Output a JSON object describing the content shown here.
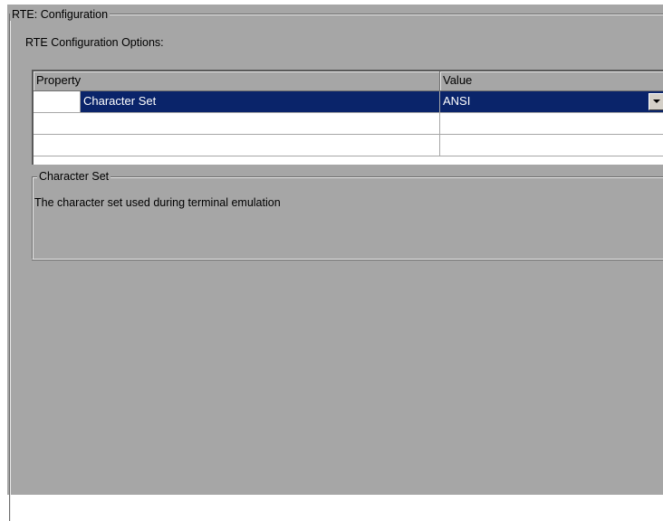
{
  "group": {
    "title": "RTE: Configuration",
    "options_label": "RTE Configuration Options:"
  },
  "grid": {
    "columns": [
      "Property",
      "Value"
    ],
    "rows": [
      {
        "property": "Character Set",
        "value": "ANSI",
        "selected": true
      },
      {
        "property": "",
        "value": "",
        "selected": false
      },
      {
        "property": "",
        "value": "",
        "selected": false
      }
    ],
    "selection_color": "#0a246a"
  },
  "description": {
    "title": "Character Set",
    "text": "The character set used during terminal emulation"
  },
  "icons": {
    "dropdown": "chevron-down-icon"
  }
}
